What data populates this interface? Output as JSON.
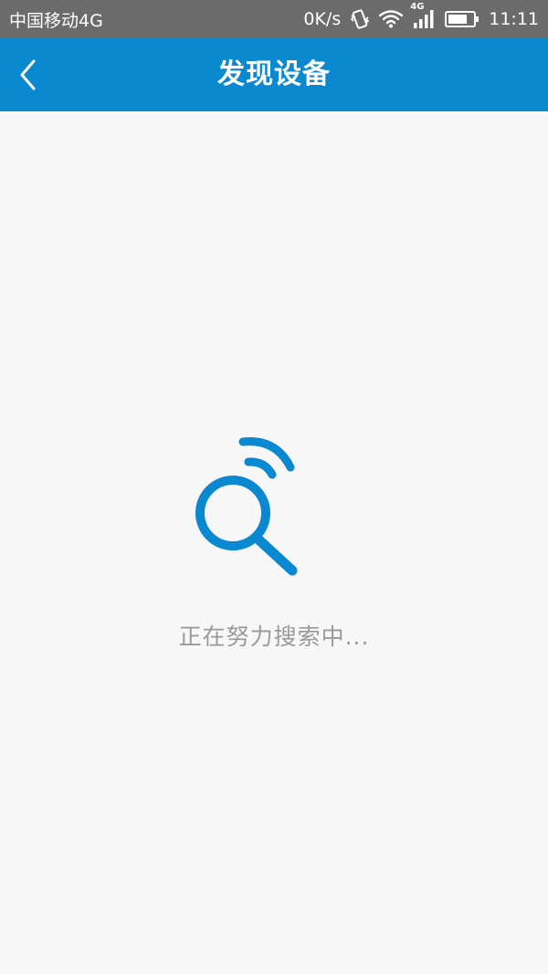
{
  "status_bar": {
    "carrier": "中国移动4G",
    "net_speed": "0K/s",
    "network_type": "4G",
    "time": "11:11",
    "icons": [
      "vibrate-icon",
      "wifi-icon",
      "signal-icon",
      "battery-icon"
    ]
  },
  "nav": {
    "title": "发现设备",
    "back_icon": "chevron-left-icon"
  },
  "main": {
    "search_icon": "search-signal-icon",
    "status_text": "正在努力搜索中..."
  },
  "colors": {
    "primary": "#0a88d0",
    "status_bar_bg": "#6b6b6b",
    "background": "#f7f7f7",
    "status_text": "#9a9a9a"
  }
}
